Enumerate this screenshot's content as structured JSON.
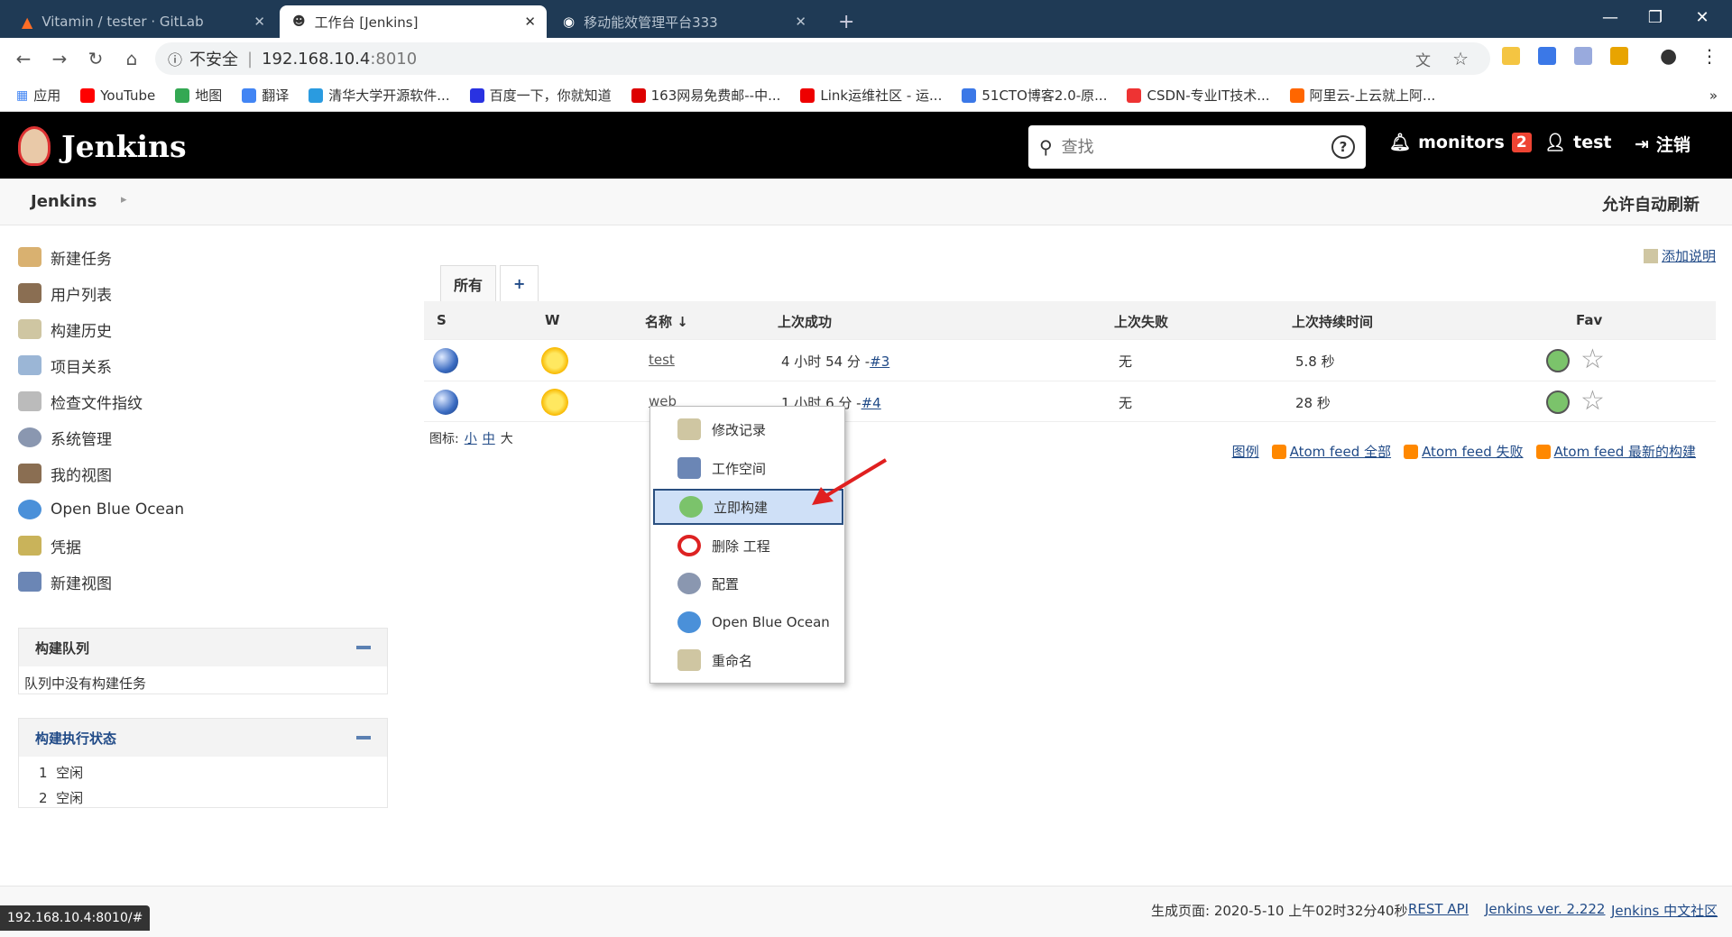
{
  "browser": {
    "tabs": [
      {
        "title": "Vitamin / tester · GitLab"
      },
      {
        "title": "工作台 [Jenkins]"
      },
      {
        "title": "移动能效管理平台333"
      }
    ],
    "url_prefix": "不安全",
    "url_host": "192.168.10.4",
    "url_port": ":8010",
    "bookmarks": [
      "应用",
      "YouTube",
      "地图",
      "翻译",
      "清华大学开源软件...",
      "百度一下，你就知道",
      "163网易免费邮--中...",
      "Link运维社区 - 运...",
      "51CTO博客2.0-原...",
      "CSDN-专业IT技术...",
      "阿里云-上云就上阿..."
    ]
  },
  "header": {
    "title": "Jenkins",
    "search_placeholder": "查找",
    "monitors_label": "monitors",
    "monitors_count": "2",
    "user": "test",
    "logout": "注销"
  },
  "breadcrumb": {
    "root": "Jenkins",
    "auto_refresh": "允许自动刷新"
  },
  "sidebar": {
    "items": [
      "新建任务",
      "用户列表",
      "构建历史",
      "项目关系",
      "检查文件指纹",
      "系统管理",
      "我的视图",
      "Open Blue Ocean",
      "凭据",
      "新建视图"
    ]
  },
  "queue": {
    "title": "构建队列",
    "empty": "队列中没有构建任务"
  },
  "executors": {
    "title": "构建执行状态",
    "rows": [
      {
        "num": "1",
        "state": "空闲"
      },
      {
        "num": "2",
        "state": "空闲"
      }
    ]
  },
  "main": {
    "add_description": "添加说明",
    "view_tabs": [
      "所有",
      "+"
    ],
    "columns": [
      "S",
      "W",
      "名称 ↓",
      "上次成功",
      "上次失败",
      "上次持续时间",
      "Fav"
    ],
    "jobs": [
      {
        "name": "test",
        "last_success": "4 小时 54 分 - ",
        "build": "#3",
        "last_failure": "无",
        "duration": "5.8 秒"
      },
      {
        "name": "web",
        "last_success": "1 小时 6 分 - ",
        "build": "#4",
        "last_failure": "无",
        "duration": "28 秒"
      }
    ],
    "icon_label": "图标:",
    "icon_sizes": [
      "小",
      "中",
      "大"
    ],
    "feeds": [
      "图例",
      "Atom feed 全部",
      "Atom feed 失败",
      "Atom feed 最新的构建"
    ]
  },
  "context_menu": {
    "items": [
      "修改记录",
      "工作空间",
      "立即构建",
      "删除 工程",
      "配置",
      "Open Blue Ocean",
      "重命名"
    ]
  },
  "footer": {
    "generated": "生成页面: 2020-5-10 上午02时32分40秒",
    "rest_api": "REST API",
    "version": "Jenkins ver. 2.222",
    "community": "Jenkins 中文社区"
  },
  "status_bar": "192.168.10.4:8010/#",
  "colors": {
    "header_bg": "#000000",
    "tab_bar": "#1f3a55",
    "highlight": "#cfe0f7",
    "badge": "#ee4433"
  }
}
